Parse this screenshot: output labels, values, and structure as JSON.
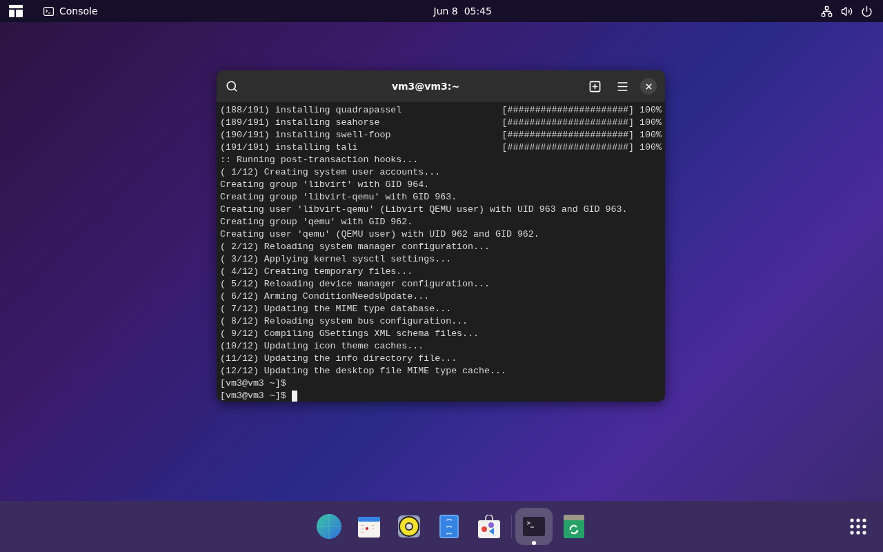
{
  "top_bar": {
    "app_label": "Console",
    "clock": "Jun 8  05:45"
  },
  "window": {
    "title": "vm3@vm3:~",
    "lines": [
      {
        "kind": "progress",
        "text": "(188/191) installing quadrapassel",
        "bar": "[######################]",
        "percent": "100%"
      },
      {
        "kind": "progress",
        "text": "(189/191) installing seahorse",
        "bar": "[######################]",
        "percent": "100%"
      },
      {
        "kind": "progress",
        "text": "(190/191) installing swell-foop",
        "bar": "[######################]",
        "percent": "100%"
      },
      {
        "kind": "progress",
        "text": "(191/191) installing tali",
        "bar": "[######################]",
        "percent": "100%"
      },
      {
        "kind": "text",
        "text": ":: Running post-transaction hooks..."
      },
      {
        "kind": "text",
        "text": "( 1/12) Creating system user accounts..."
      },
      {
        "kind": "text",
        "text": "Creating group 'libvirt' with GID 964."
      },
      {
        "kind": "text",
        "text": "Creating group 'libvirt-qemu' with GID 963."
      },
      {
        "kind": "text",
        "text": "Creating user 'libvirt-qemu' (Libvirt QEMU user) with UID 963 and GID 963."
      },
      {
        "kind": "text",
        "text": "Creating group 'qemu' with GID 962."
      },
      {
        "kind": "text",
        "text": "Creating user 'qemu' (QEMU user) with UID 962 and GID 962."
      },
      {
        "kind": "text",
        "text": "( 2/12) Reloading system manager configuration..."
      },
      {
        "kind": "text",
        "text": "( 3/12) Applying kernel sysctl settings..."
      },
      {
        "kind": "text",
        "text": "( 4/12) Creating temporary files..."
      },
      {
        "kind": "text",
        "text": "( 5/12) Reloading device manager configuration..."
      },
      {
        "kind": "text",
        "text": "( 6/12) Arming ConditionNeedsUpdate..."
      },
      {
        "kind": "text",
        "text": "( 7/12) Updating the MIME type database..."
      },
      {
        "kind": "text",
        "text": "( 8/12) Reloading system bus configuration..."
      },
      {
        "kind": "text",
        "text": "( 9/12) Compiling GSettings XML schema files..."
      },
      {
        "kind": "text",
        "text": "(10/12) Updating icon theme caches..."
      },
      {
        "kind": "text",
        "text": "(11/12) Updating the info directory file..."
      },
      {
        "kind": "text",
        "text": "(12/12) Updating the desktop file MIME type cache..."
      },
      {
        "kind": "prompt",
        "text": "[vm3@vm3 ~]$",
        "cursor": false
      },
      {
        "kind": "prompt",
        "text": "[vm3@vm3 ~]$",
        "cursor": true
      }
    ]
  },
  "dock": [
    {
      "kind": "browser",
      "running": false
    },
    {
      "kind": "calendar",
      "running": false
    },
    {
      "kind": "speaker",
      "running": false
    },
    {
      "kind": "files",
      "running": false
    },
    {
      "kind": "store",
      "running": false
    },
    {
      "kind": "terminal",
      "running": true
    },
    {
      "kind": "trash",
      "running": false
    }
  ]
}
